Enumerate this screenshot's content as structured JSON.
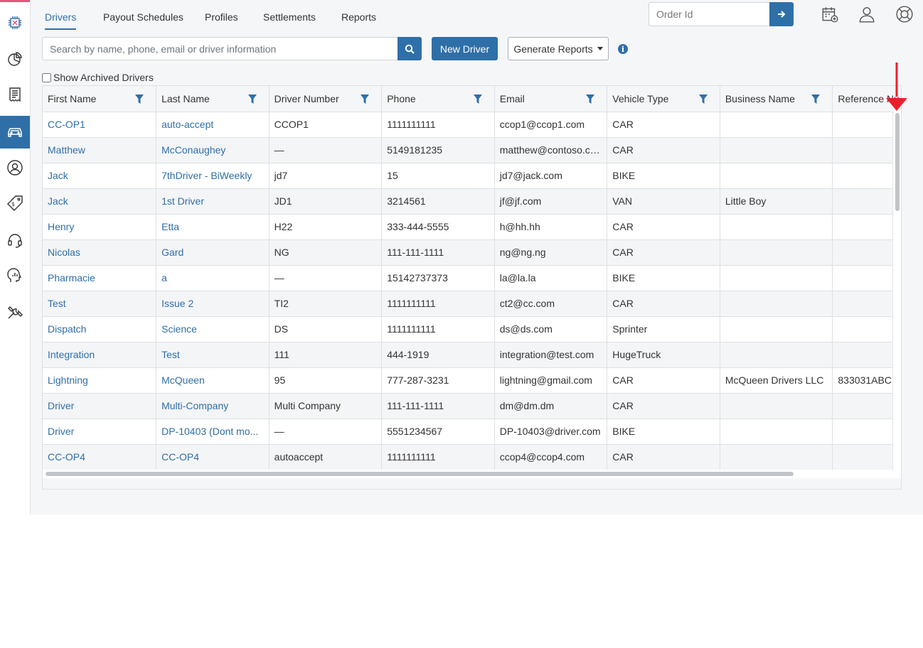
{
  "tabs": [
    {
      "label": "Drivers",
      "active": true
    },
    {
      "label": "Payout Schedules",
      "active": false
    },
    {
      "label": "Profiles",
      "active": false
    },
    {
      "label": "Settlements",
      "active": false
    },
    {
      "label": "Reports",
      "active": false
    }
  ],
  "order_search": {
    "placeholder": "Order Id"
  },
  "toolbar": {
    "search_placeholder": "Search by name, phone, email or driver information",
    "new_driver_label": "New Driver",
    "generate_reports_label": "Generate Reports",
    "show_archived_label": "Show Archived Drivers"
  },
  "sidebar": {
    "items": [
      {
        "icon": "circuit-logo-icon"
      },
      {
        "icon": "pie-chart-icon"
      },
      {
        "icon": "receipt-icon"
      },
      {
        "icon": "car-icon",
        "active": true
      },
      {
        "icon": "user-circle-icon"
      },
      {
        "icon": "price-tag-icon"
      },
      {
        "icon": "headset-icon"
      },
      {
        "icon": "analytics-head-icon"
      },
      {
        "icon": "tools-icon"
      }
    ]
  },
  "table": {
    "columns": [
      "First Name",
      "Last Name",
      "Driver Number",
      "Phone",
      "Email",
      "Vehicle Type",
      "Business Name",
      "Reference Nu..."
    ],
    "rows": [
      [
        "CC-OP1",
        "auto-accept",
        "CCOP1",
        "1111111111",
        "ccop1@ccop1.com",
        "CAR",
        "",
        ""
      ],
      [
        "Matthew",
        "McConaughey",
        "—",
        "5149181235",
        "matthew@contoso.com",
        "CAR",
        "",
        ""
      ],
      [
        "Jack",
        "7thDriver - BiWeekly",
        "jd7",
        "15",
        "jd7@jack.com",
        "BIKE",
        "",
        ""
      ],
      [
        "Jack",
        "1st Driver",
        "JD1",
        "3214561",
        "jf@jf.com",
        "VAN",
        "Little Boy",
        ""
      ],
      [
        "Henry",
        "Etta",
        "H22",
        "333-444-5555",
        "h@hh.hh",
        "CAR",
        "",
        ""
      ],
      [
        "Nicolas",
        "Gard",
        "NG",
        "111-111-1111",
        "ng@ng.ng",
        "CAR",
        "",
        ""
      ],
      [
        "Pharmacie",
        "a",
        "—",
        "15142737373",
        "la@la.la",
        "BIKE",
        "",
        ""
      ],
      [
        "Test",
        "Issue 2",
        "TI2",
        "1111111111",
        "ct2@cc.com",
        "CAR",
        "",
        ""
      ],
      [
        "Dispatch",
        "Science",
        "DS",
        "1111111111",
        "ds@ds.com",
        "Sprinter",
        "",
        ""
      ],
      [
        "Integration",
        "Test",
        "111",
        "444-1919",
        "integration@test.com",
        "HugeTruck",
        "",
        ""
      ],
      [
        "Lightning",
        "McQueen",
        "95",
        "777-287-3231",
        "lightning@gmail.com",
        "CAR",
        "McQueen Drivers LLC",
        "833031ABC"
      ],
      [
        "Driver",
        "Multi-Company",
        "Multi Company",
        "111-111-1111",
        "dm@dm.dm",
        "CAR",
        "",
        ""
      ],
      [
        "Driver",
        "DP-10403 (Dont mo...",
        "—",
        "5551234567",
        "DP-10403@driver.com",
        "BIKE",
        "",
        ""
      ],
      [
        "CC-OP4",
        "CC-OP4",
        "autoaccept",
        "1111111111",
        "ccop4@ccop4.com",
        "CAR",
        "",
        ""
      ]
    ]
  },
  "colors": {
    "accent": "#2f6fa8",
    "brand_pink": "#e8557c",
    "annotation_arrow": "#e8202a"
  }
}
